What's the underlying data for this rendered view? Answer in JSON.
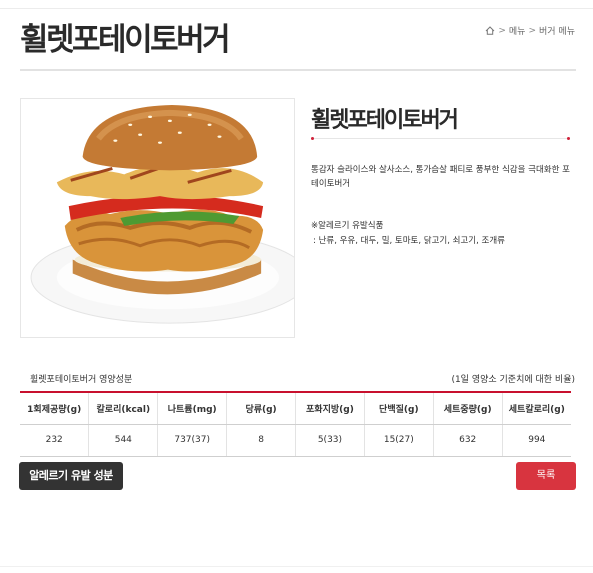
{
  "page": {
    "title": "휠렛포테이토버거"
  },
  "breadcrumb": {
    "home_icon": "home-icon",
    "separator": ">",
    "items": [
      "메뉴",
      "버거 메뉴"
    ]
  },
  "product": {
    "name": "휠렛포테이토버거",
    "description": "통감자 슬라이스와 살사소스, 통가슴살 패티로 풍부한 식감을 극대화한 포테이토버거",
    "allergen_title": "※알레르기 유발식품",
    "allergen_list": ": 난류, 우유, 대두, 밀, 토마토, 닭고기, 쇠고기, 조개류",
    "image_desc": "burger-photo"
  },
  "nutrition": {
    "title": "휠렛포테이토버거 영양성분",
    "note": "(1일 영양소 기준치에 대한 비율)",
    "headers": [
      "1회제공량(g)",
      "칼로리(kcal)",
      "나트륨(mg)",
      "당류(g)",
      "포화지방(g)",
      "단백질(g)",
      "세트중량(g)",
      "세트칼로리(g)"
    ],
    "values": [
      "232",
      "544",
      "737(37)",
      "8",
      "5(33)",
      "15(27)",
      "632",
      "994"
    ]
  },
  "buttons": {
    "allergen": "알레르기 유발 성분",
    "list": "목록"
  },
  "colors": {
    "accent": "#c8102e",
    "list_button": "#d8343f",
    "dark_button": "#333333"
  }
}
